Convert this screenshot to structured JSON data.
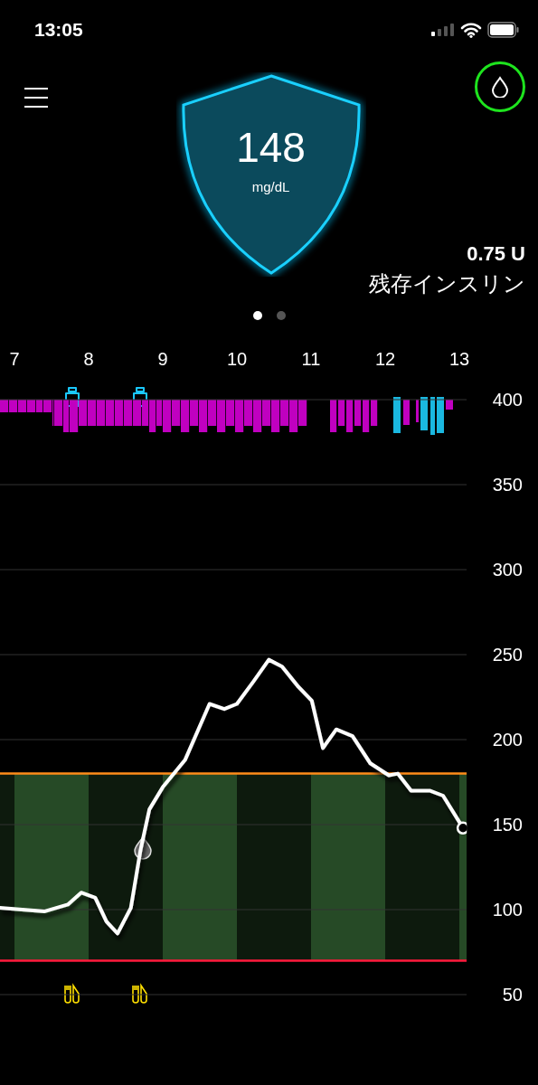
{
  "status_bar": {
    "time": "13:05"
  },
  "header": {
    "glucose": {
      "value": "148",
      "unit": "mg/dL"
    },
    "insulin": {
      "amount": "0.75 U",
      "label": "残存インスリン"
    }
  },
  "pager": [
    {
      "selected": true
    },
    {
      "selected": false
    }
  ],
  "chart": {
    "chart_data": {
      "type": "line",
      "x": [
        6.8,
        7.41,
        7.72,
        7.9,
        8.09,
        8.24,
        8.39,
        8.57,
        8.7,
        8.82,
        9.0,
        9.3,
        9.63,
        9.83,
        10.0,
        10.22,
        10.43,
        10.61,
        10.83,
        11.01,
        11.16,
        11.34,
        11.56,
        11.8,
        12.05,
        12.17,
        12.35,
        12.6,
        12.78,
        13.05
      ],
      "series": [
        {
          "color": "#ffffff",
          "values": [
            101,
            99,
            103,
            110,
            107,
            93,
            86,
            101,
            135,
            159,
            172,
            188,
            221,
            218,
            221,
            234,
            247,
            243,
            231,
            223,
            195,
            206,
            202,
            186,
            179,
            180,
            170,
            170,
            167,
            148
          ]
        }
      ],
      "xlim": [
        6.8,
        13.1
      ],
      "ylim": [
        50,
        400
      ],
      "xticks": [
        7,
        8,
        9,
        10,
        11,
        12,
        13
      ],
      "yticks": [
        50,
        100,
        150,
        200,
        250,
        300,
        350,
        400
      ],
      "grid": true
    }
  }
}
